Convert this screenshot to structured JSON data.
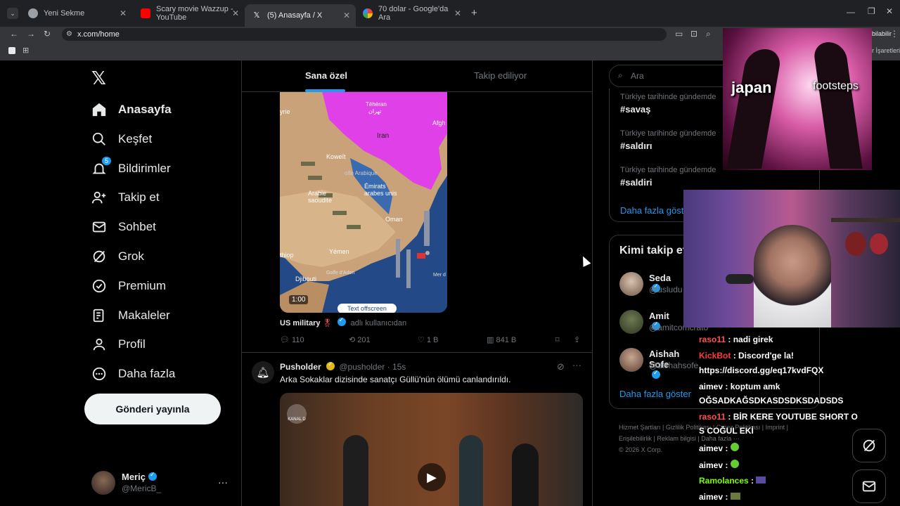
{
  "browser": {
    "tabs": [
      {
        "label": "Yeni Sekme"
      },
      {
        "label": "Scary movie Wazzup - YouTube"
      },
      {
        "label": "(5) Anasayfa / X"
      },
      {
        "label": "70 dolar - Google'da Ara"
      }
    ],
    "url": "x.com/home",
    "bookmarks_right": "r İşaretleri",
    "extra_label": "bilabilir"
  },
  "sidebar": {
    "items": [
      {
        "label": "Anasayfa"
      },
      {
        "label": "Keşfet"
      },
      {
        "label": "Bildirimler",
        "badge": "5"
      },
      {
        "label": "Takip et"
      },
      {
        "label": "Sohbet"
      },
      {
        "label": "Grok"
      },
      {
        "label": "Premium"
      },
      {
        "label": "Makaleler"
      },
      {
        "label": "Profil"
      },
      {
        "label": "Daha fazla"
      }
    ],
    "post_button": "Gönderi yayınla",
    "account": {
      "name": "Meriç",
      "handle": "@MericB_"
    }
  },
  "feed": {
    "tabs": [
      "Sana özel",
      "Takip ediliyor"
    ],
    "post1": {
      "map_labels": {
        "teheran": "Téhéran",
        "teheran_ar": "تهران",
        "iran": "Iran",
        "afg": "Afgh",
        "syrie": "yrie",
        "koweit": "Koweït",
        "golfe": "olfe Arabique",
        "emirats": "Émirats arabes unis",
        "arabie": "Arabie saoudite",
        "oman": "Oman",
        "yemen": "Yémen",
        "thiopie": "thiop",
        "golfe_aden": "Golfe d'Aden",
        "djibouti": "Djibouti",
        "mer": "Mer d"
      },
      "duration": "1:00",
      "caption": "Text offscreen",
      "author": "US military",
      "author_suffix": "adlı kullanıcıdan",
      "replies": "110",
      "reposts": "201",
      "likes": "1 B",
      "views": "841 B"
    },
    "post2": {
      "name": "Pusholder",
      "handle": "@pusholder",
      "time": "· 15s",
      "text": "Arka Sokaklar dizisinde sanatçı Güllü'nün ölümü canlandırıldı.",
      "channel": "KANAL D"
    }
  },
  "right": {
    "search_placeholder": "Ara",
    "trends": [
      {
        "sub": "Türkiye tarihinde gündemde",
        "tag": "#savaş"
      },
      {
        "sub": "Türkiye tarihinde gündemde",
        "tag": "#saldırı"
      },
      {
        "sub": "Türkiye tarihinde gündemde",
        "tag": "#saldiri"
      }
    ],
    "show_more": "Daha fazla göster",
    "who_to_follow_title": "Kimi takip et",
    "follow": [
      {
        "name": "Seda",
        "handle": "@usludu"
      },
      {
        "name": "Amit",
        "handle": "@amitcomcrato"
      },
      {
        "name": "Aishah Sofe",
        "handle": "@aishahsofe"
      }
    ],
    "follow_button": "Takip et",
    "show_more2": "Daha fazla göster",
    "footer": [
      "Hizmet Şartları",
      "Gizlilik Politikası",
      "Çerez Politikası",
      "Imprint",
      "Erişilebilirlik",
      "Reklam bilgisi",
      "Daha fazla ···"
    ],
    "copyright": "© 2026 X Corp."
  },
  "overlay": {
    "meme_left": "japan",
    "meme_right": "footsteps",
    "chat": [
      {
        "user": "raso11",
        "msg": ": nadi girek",
        "color": "#ff5252"
      },
      {
        "user": "KickBot",
        "msg": ": Discord'ge la!",
        "color": "#ff3b3b"
      },
      {
        "user": "",
        "msg": "https://discord.gg/eq17kvdFQX",
        "color": "#fff"
      },
      {
        "user": "aimev",
        "msg": ": koptum amk",
        "color": "#fff"
      },
      {
        "user": "",
        "msg": "OĞSADKAĞSDKASDSDKSDADSDS",
        "color": "#fff"
      },
      {
        "user": "raso11",
        "msg": ": BİR KERE YOUTUBE SHORT O",
        "color": "#ff5252"
      },
      {
        "user": "",
        "msg": "S COĞUL EKİ",
        "color": "#fff"
      },
      {
        "user": "aimev",
        "msg": ":",
        "color": "#fff"
      },
      {
        "user": "aimev",
        "msg": ":",
        "color": "#fff"
      },
      {
        "user": "Ramolances",
        "msg": ":",
        "color": "#7CFC00"
      },
      {
        "user": "aimev",
        "msg": ":",
        "color": "#fff"
      }
    ]
  }
}
